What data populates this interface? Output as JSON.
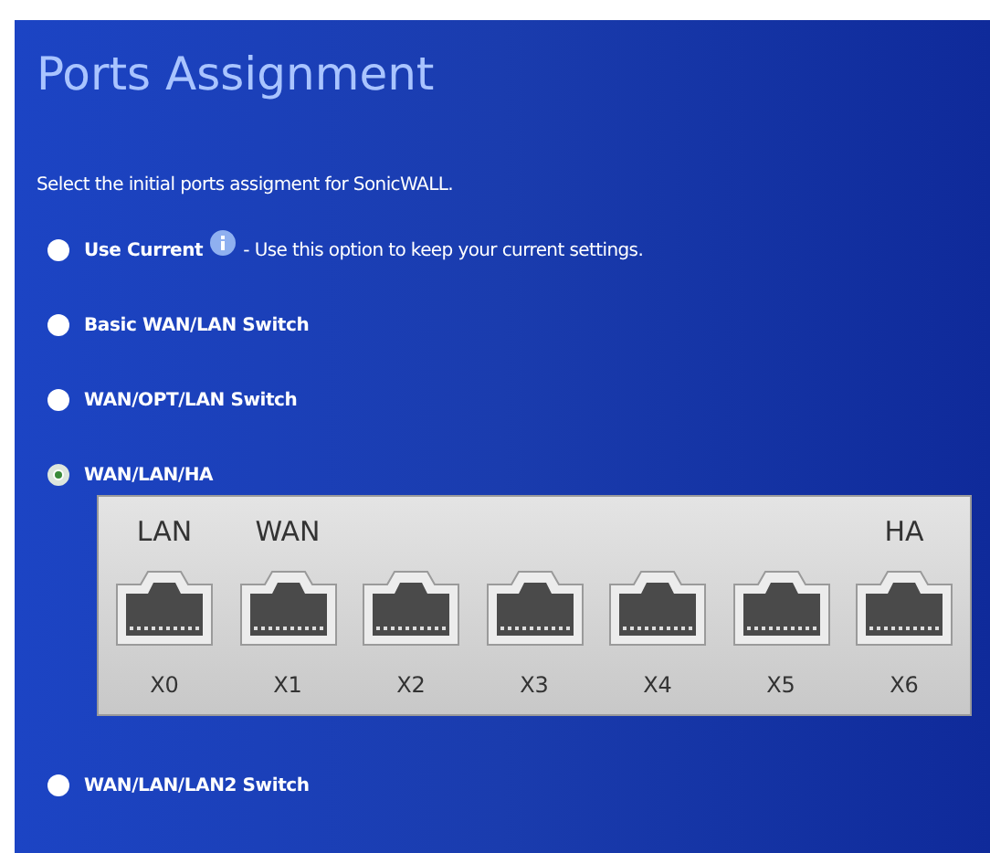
{
  "title": "Ports Assignment",
  "intro": "Select the initial ports assigment for SonicWALL.",
  "options": [
    {
      "label": "Use Current",
      "selected": false,
      "description": "- Use this option to keep your current settings."
    },
    {
      "label": "Basic WAN/LAN Switch",
      "selected": false
    },
    {
      "label": "WAN/OPT/LAN Switch",
      "selected": false
    },
    {
      "label": "WAN/LAN/HA",
      "selected": true,
      "ports": [
        {
          "name": "X0",
          "role": "LAN"
        },
        {
          "name": "X1",
          "role": "WAN"
        },
        {
          "name": "X2"
        },
        {
          "name": "X3"
        },
        {
          "name": "X4"
        },
        {
          "name": "X5"
        },
        {
          "name": "X6",
          "role": "HA"
        }
      ]
    },
    {
      "label": "WAN/LAN/LAN2 Switch",
      "selected": false
    }
  ]
}
